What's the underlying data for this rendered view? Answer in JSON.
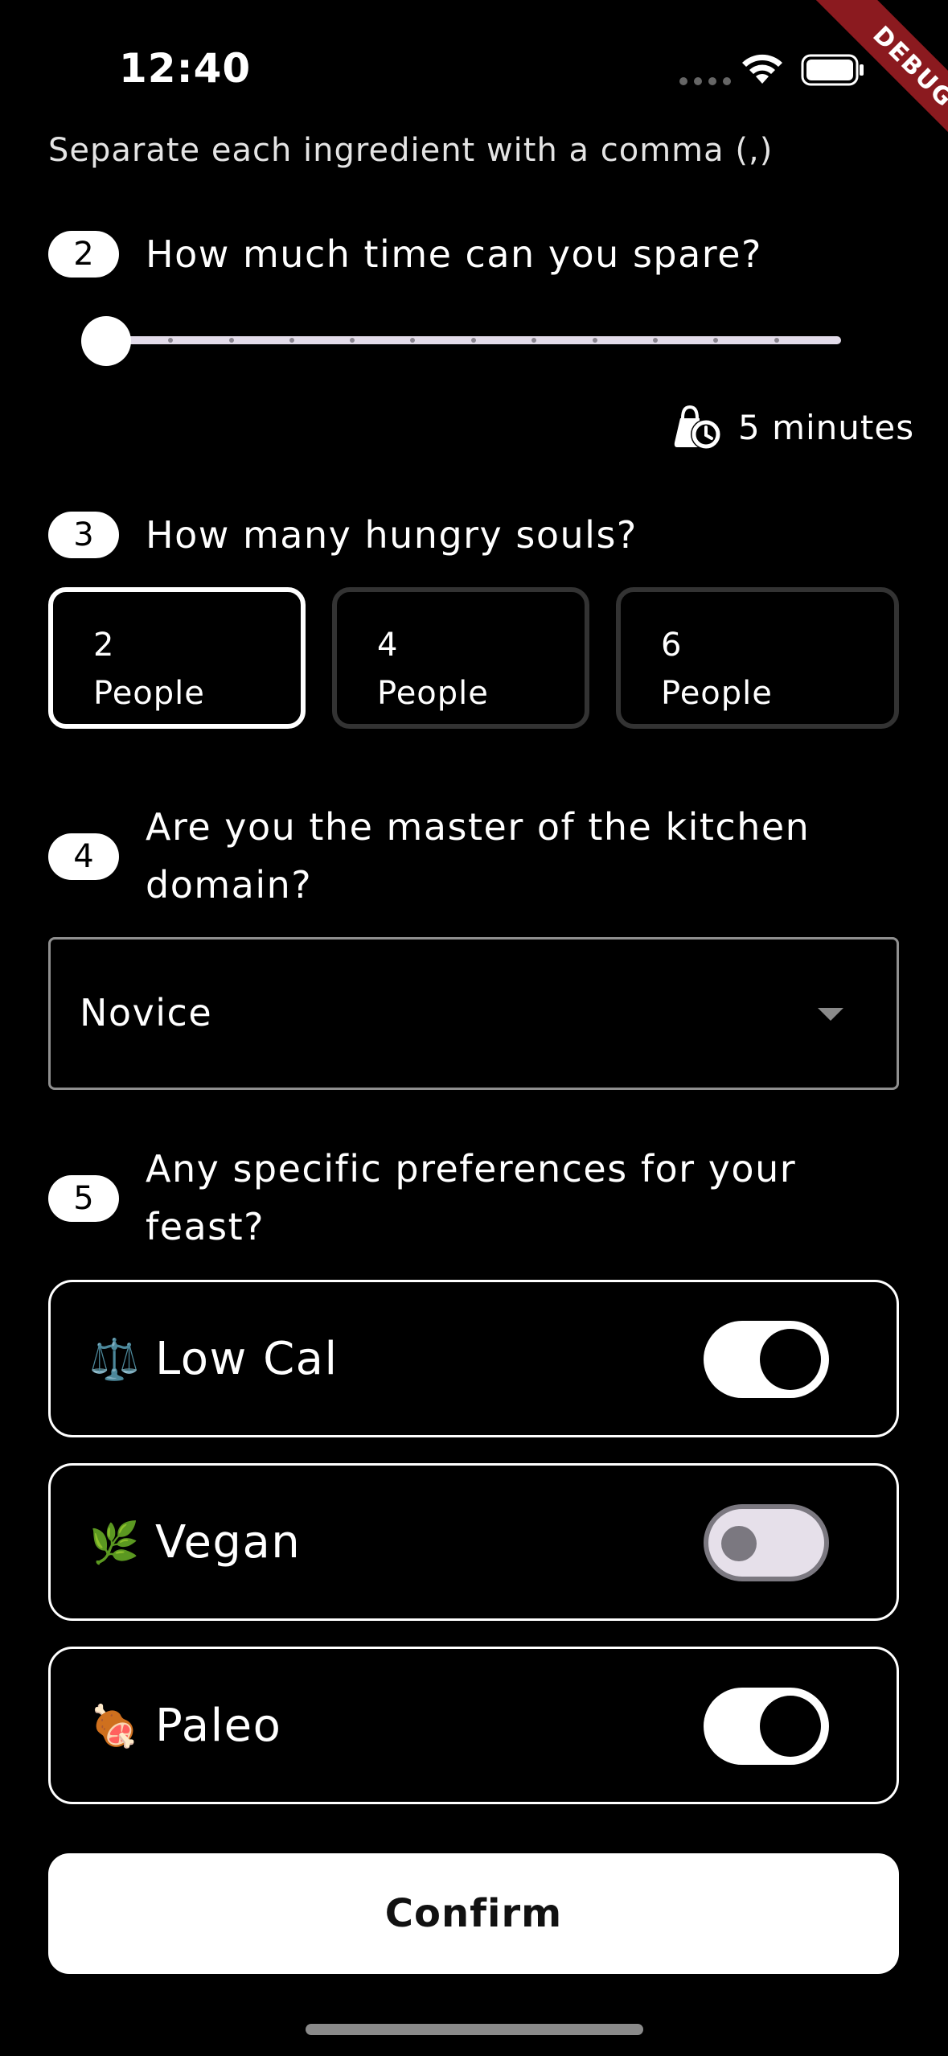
{
  "status_bar": {
    "time": "12:40"
  },
  "debug_banner": "DEBUG",
  "ingredients": {
    "helper": "Separate each ingredient with a comma (,)"
  },
  "time_step": {
    "number": "2",
    "title": "How much time can you spare?",
    "slider_value_fraction": 0,
    "readout": "5 minutes",
    "icon": "timer-bag-icon"
  },
  "people_step": {
    "number": "3",
    "title": "How many hungry souls?",
    "options": [
      {
        "count": "2",
        "unit": "People",
        "selected": true
      },
      {
        "count": "4",
        "unit": "People",
        "selected": false
      },
      {
        "count": "6",
        "unit": "People",
        "selected": false
      }
    ]
  },
  "skill_step": {
    "number": "4",
    "title_line1": "Are you the master of the kitchen",
    "title_line2": "domain?",
    "selected": "Novice"
  },
  "prefs_step": {
    "number": "5",
    "title_line1": "Any specific preferences for your",
    "title_line2": "feast?",
    "items": [
      {
        "emoji": "⚖️",
        "label": "Low Cal",
        "enabled": true
      },
      {
        "emoji": "🌿",
        "label": "Vegan",
        "enabled": false
      },
      {
        "emoji": "🍖",
        "label": "Paleo",
        "enabled": true
      }
    ]
  },
  "confirm_label": "Confirm",
  "colors": {
    "background": "#000000",
    "foreground": "#ffffff",
    "debug_banner": "#8b1a1f"
  }
}
